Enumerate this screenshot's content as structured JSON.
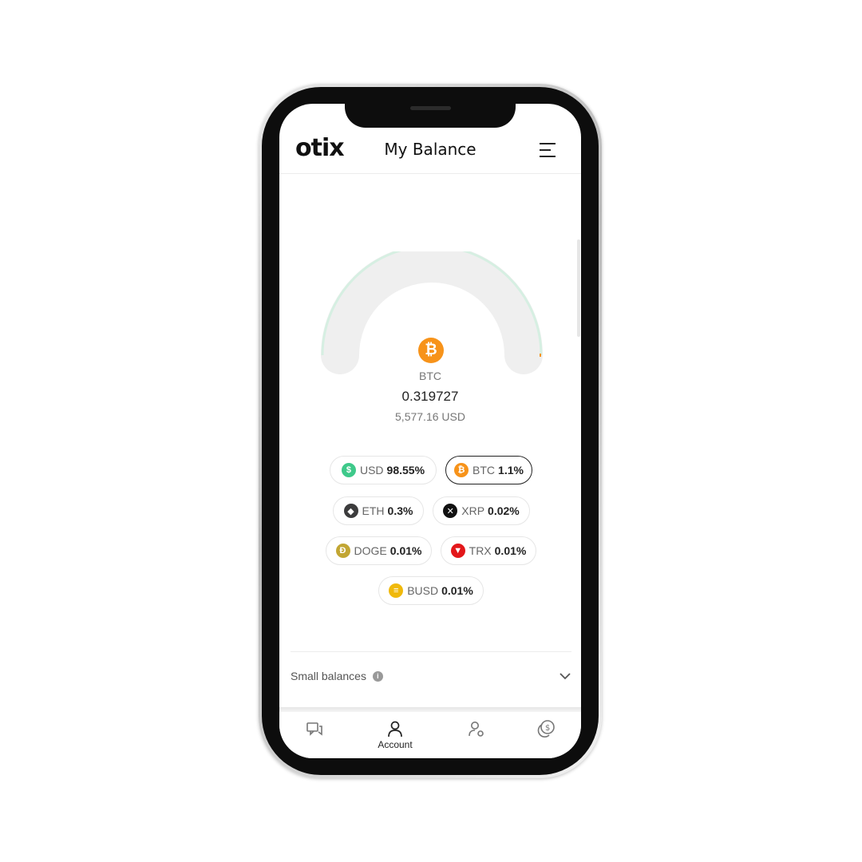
{
  "header": {
    "logo": "otix",
    "title": "My Balance",
    "menu_icon": "hamburger-menu-icon"
  },
  "selected_coin": {
    "icon": "bitcoin-icon",
    "symbol": "BTC",
    "amount": "0.319727",
    "usd_value": "5,577.16 USD"
  },
  "allocation": [
    {
      "symbol": "USD",
      "percent": "98.55%",
      "icon": "dollar-icon",
      "color": "#3ec98a",
      "selected": false
    },
    {
      "symbol": "BTC",
      "percent": "1.1%",
      "icon": "bitcoin-icon",
      "color": "#f7931a",
      "selected": true
    },
    {
      "symbol": "ETH",
      "percent": "0.3%",
      "icon": "ethereum-icon",
      "color": "#3c3c3d",
      "selected": false
    },
    {
      "symbol": "XRP",
      "percent": "0.02%",
      "icon": "xrp-icon",
      "color": "#111111",
      "selected": false
    },
    {
      "symbol": "DOGE",
      "percent": "0.01%",
      "icon": "dogecoin-icon",
      "color": "#c2a633",
      "selected": false
    },
    {
      "symbol": "TRX",
      "percent": "0.01%",
      "icon": "tron-icon",
      "color": "#e3171a",
      "selected": false
    },
    {
      "symbol": "BUSD",
      "percent": "0.01%",
      "icon": "busd-icon",
      "color": "#f0b90b",
      "selected": false
    }
  ],
  "gauge": {
    "track_color": "#efefef",
    "usd_color": "#d6efe2",
    "btc_color": "#f7931a",
    "btc_fraction": 0.011
  },
  "small_balances": {
    "label": "Small balances"
  },
  "nav": {
    "items": [
      {
        "icon": "chat-icon",
        "label": ""
      },
      {
        "icon": "account-icon",
        "label": "Account"
      },
      {
        "icon": "user-settings-icon",
        "label": ""
      },
      {
        "icon": "coins-icon",
        "label": ""
      }
    ]
  }
}
